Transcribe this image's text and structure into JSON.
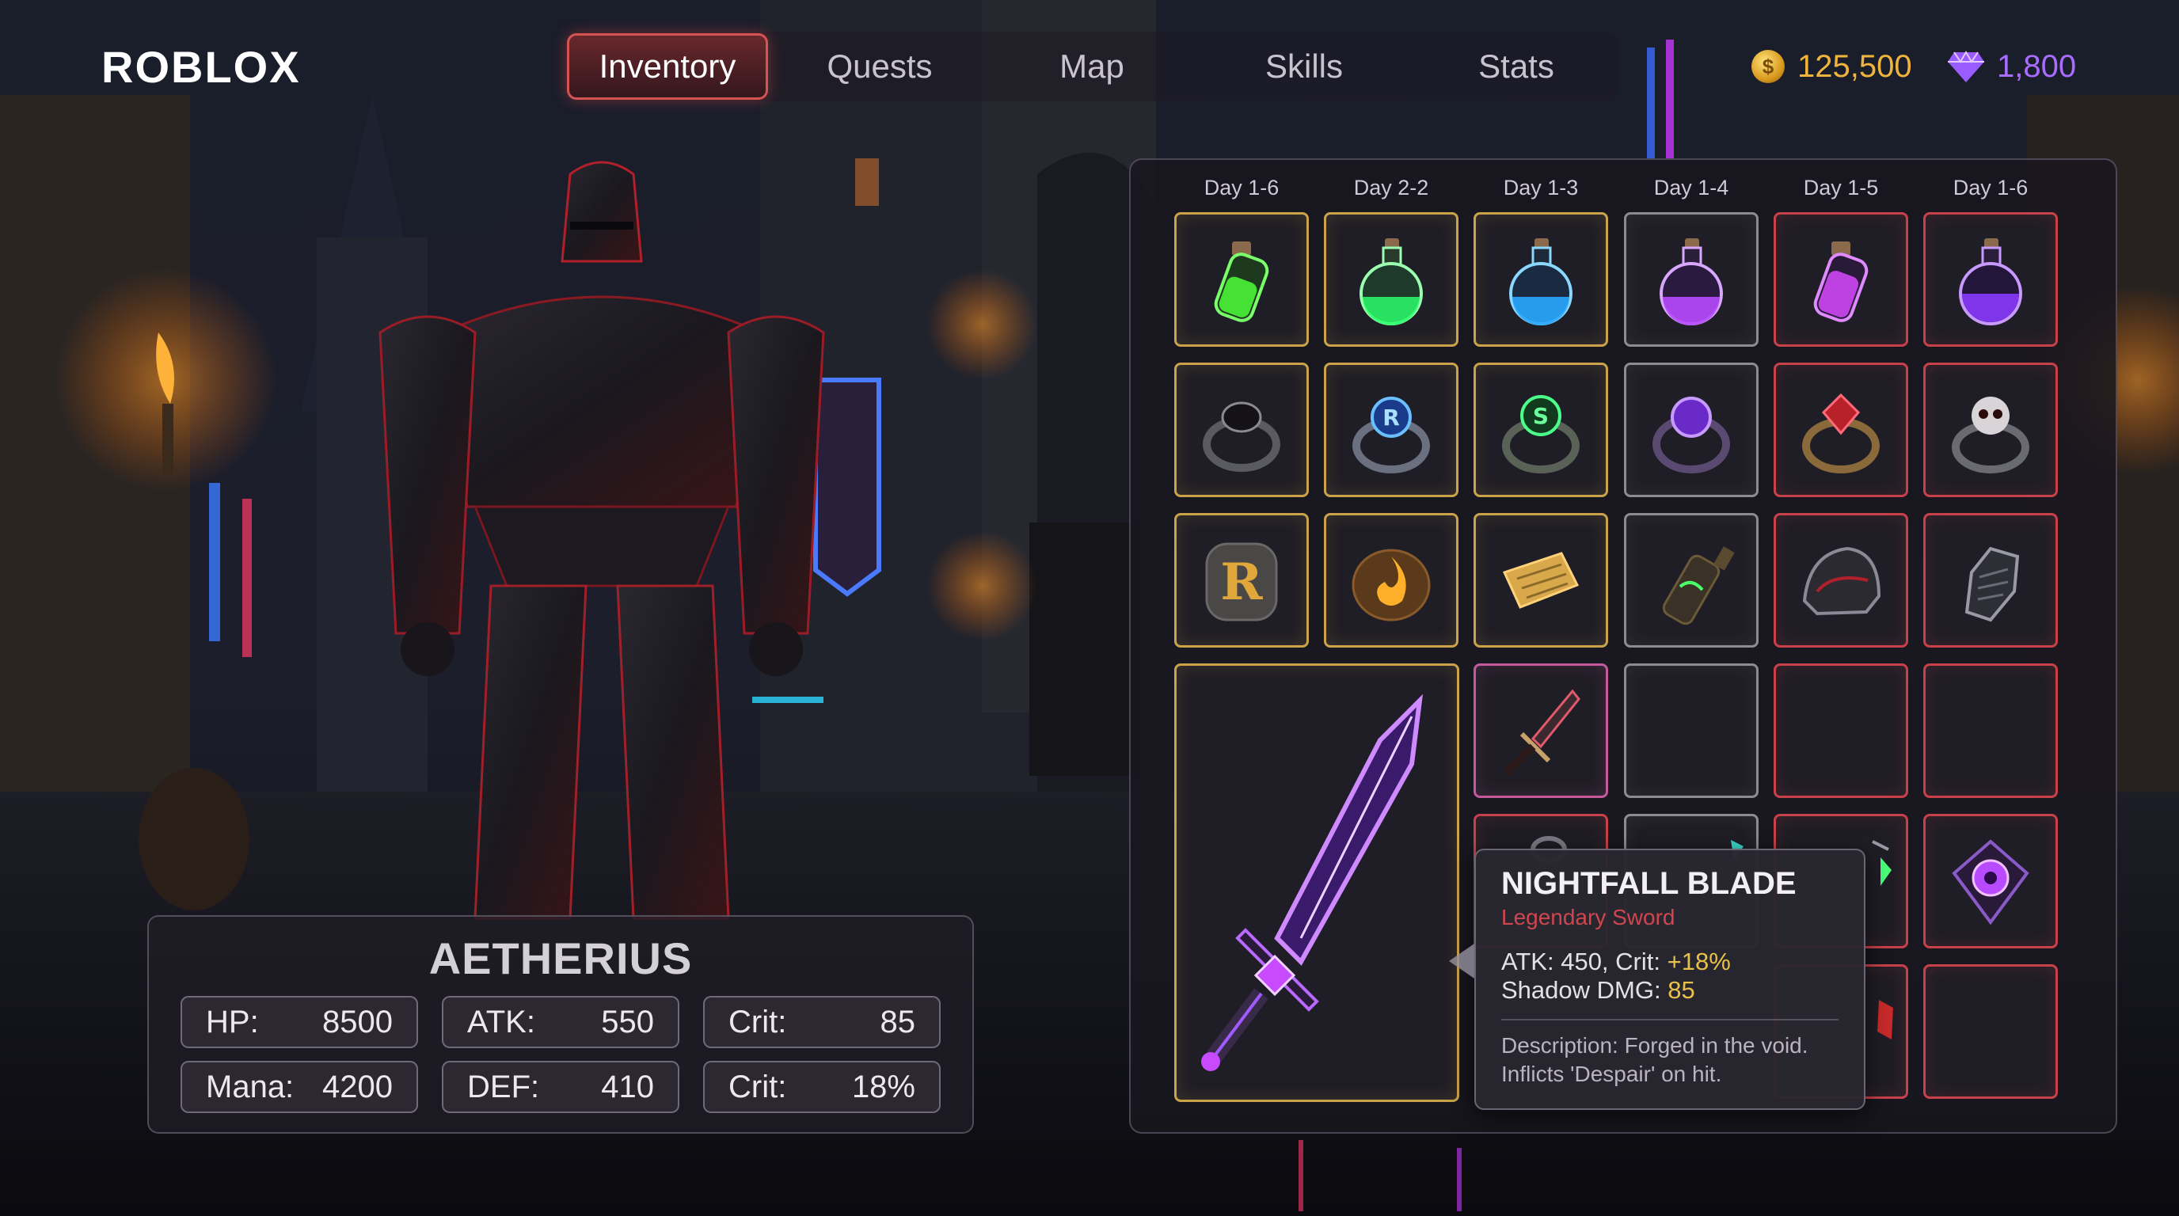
{
  "brand": {
    "logo": "ROBLOX"
  },
  "nav": {
    "tabs": [
      {
        "label": "Inventory",
        "active": true
      },
      {
        "label": "Quests"
      },
      {
        "label": "Map"
      },
      {
        "label": "Skills"
      },
      {
        "label": "Stats"
      }
    ]
  },
  "currency": {
    "coins": {
      "value": "125,500",
      "icon": "gold-coin-icon",
      "color": "#f0b43c"
    },
    "gems": {
      "value": "1,800",
      "icon": "purple-gem-icon",
      "color": "#a86cff"
    }
  },
  "character": {
    "name": "AETHERIUS",
    "stats": [
      {
        "label": "HP:",
        "value": "8500"
      },
      {
        "label": "ATK:",
        "value": "550"
      },
      {
        "label": "Crit:",
        "value": "85"
      },
      {
        "label": "Mana:",
        "value": "4200"
      },
      {
        "label": "DEF:",
        "value": "410"
      },
      {
        "label": "Crit:",
        "value": "18%"
      }
    ]
  },
  "inventory": {
    "columns": [
      "Day 1-6",
      "Day 2-2",
      "Day 1-3",
      "Day 1-4",
      "Day 1-5",
      "Day 1-6"
    ],
    "slots": [
      {
        "item": "green-potion-vial",
        "rarity": "gold"
      },
      {
        "item": "green-potion-flask",
        "rarity": "gold"
      },
      {
        "item": "blue-potion-flask",
        "rarity": "gold"
      },
      {
        "item": "purple-potion-flask",
        "rarity": "gray"
      },
      {
        "item": "violet-potion-vial",
        "rarity": "red"
      },
      {
        "item": "purple-potion-flask",
        "rarity": "red"
      },
      {
        "item": "black-onyx-ring",
        "rarity": "gold"
      },
      {
        "item": "blue-rune-ring",
        "rarity": "gold"
      },
      {
        "item": "green-rune-ring",
        "rarity": "gold"
      },
      {
        "item": "amethyst-ring",
        "rarity": "gray"
      },
      {
        "item": "ruby-ring",
        "rarity": "red"
      },
      {
        "item": "skull-ring",
        "rarity": "red"
      },
      {
        "item": "rune-stone",
        "rarity": "gold"
      },
      {
        "item": "fire-essence",
        "rarity": "gold"
      },
      {
        "item": "ancient-scroll",
        "rarity": "gold"
      },
      {
        "item": "cursed-bottle",
        "rarity": "gray"
      },
      {
        "item": "shoulder-pauldron",
        "rarity": "red"
      },
      {
        "item": "iron-gauntlet",
        "rarity": "red"
      },
      {
        "item": "nightfall-blade",
        "rarity": "gold"
      },
      {
        "item": "crimson-dagger",
        "rarity": "pink"
      },
      {
        "item": "empty",
        "rarity": "gray"
      },
      {
        "item": "empty",
        "rarity": "red"
      },
      {
        "item": "empty",
        "rarity": "red"
      },
      {
        "item": "ring-partial",
        "rarity": "red"
      },
      {
        "item": "crystal-partial",
        "rarity": "gray"
      },
      {
        "item": "green-crystal-partial",
        "rarity": "red"
      },
      {
        "item": "void-amulet",
        "rarity": "red"
      },
      {
        "item": "red-item-partial",
        "rarity": "red"
      },
      {
        "item": "empty",
        "rarity": "red"
      }
    ]
  },
  "tooltip": {
    "name": "NIGHTFALL BLADE",
    "type": "Legendary Sword",
    "atk_text": "ATK: 450, Crit: ",
    "crit_bonus": "+18%",
    "shadow_label": "Shadow DMG: ",
    "shadow_value": "85",
    "description": "Description: Forged in the void. Inflicts 'Despair' on hit."
  }
}
